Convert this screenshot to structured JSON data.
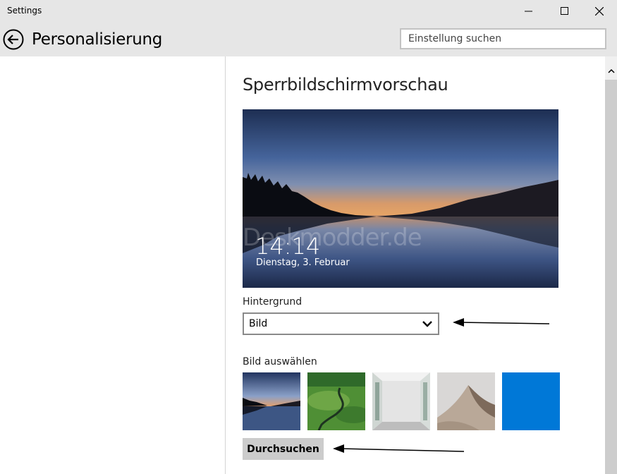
{
  "window": {
    "title": "Settings"
  },
  "header": {
    "page_title": "Personalisierung",
    "search_placeholder": "Einstellung suchen"
  },
  "content": {
    "section_title": "Sperrbildschirmvorschau",
    "preview": {
      "time": "14:14",
      "date": "Dienstag, 3. Februar",
      "watermark": "Deskmodder.de"
    },
    "background_label": "Hintergrund",
    "background_value": "Bild",
    "choose_label": "Bild auswählen",
    "browse_label": "Durchsuchen",
    "accent_color": "#0078d7"
  }
}
